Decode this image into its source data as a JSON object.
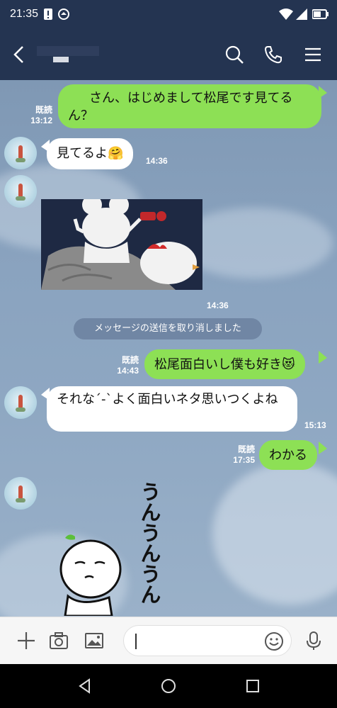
{
  "status_bar": {
    "time": "21:35"
  },
  "header": {
    "back_icon": "chevron-left-icon",
    "search_icon": "search-icon",
    "call_icon": "phone-icon",
    "menu_icon": "menu-icon"
  },
  "messages": {
    "m1": {
      "text": "さん、はじめまして松尾です見てるん？",
      "read": "既読",
      "time": "13:12"
    },
    "m2": {
      "text": "見てるよ🤗",
      "time": "14:36"
    },
    "m3": {
      "time": "14:36"
    },
    "system": "メッセージの送信を取り消しました",
    "m4": {
      "text": "松尾面白いし僕も好き😻",
      "read": "既読",
      "time": "14:43"
    },
    "m5": {
      "text": "それな´-`よく面白いネタ思いつくよね",
      "time": "15:13"
    },
    "m6": {
      "text": "わかる",
      "read": "既読",
      "time": "17:35"
    },
    "m7": {
      "sticker_text": "うんうんうん"
    }
  },
  "input_bar": {
    "plus_icon": "plus-icon",
    "camera_icon": "camera-icon",
    "image_icon": "image-icon",
    "emoji_icon": "emoji-icon",
    "mic_icon": "microphone-icon"
  },
  "nav_bar": {
    "back": "nav-back-icon",
    "home": "nav-home-icon",
    "recents": "nav-recents-icon"
  }
}
